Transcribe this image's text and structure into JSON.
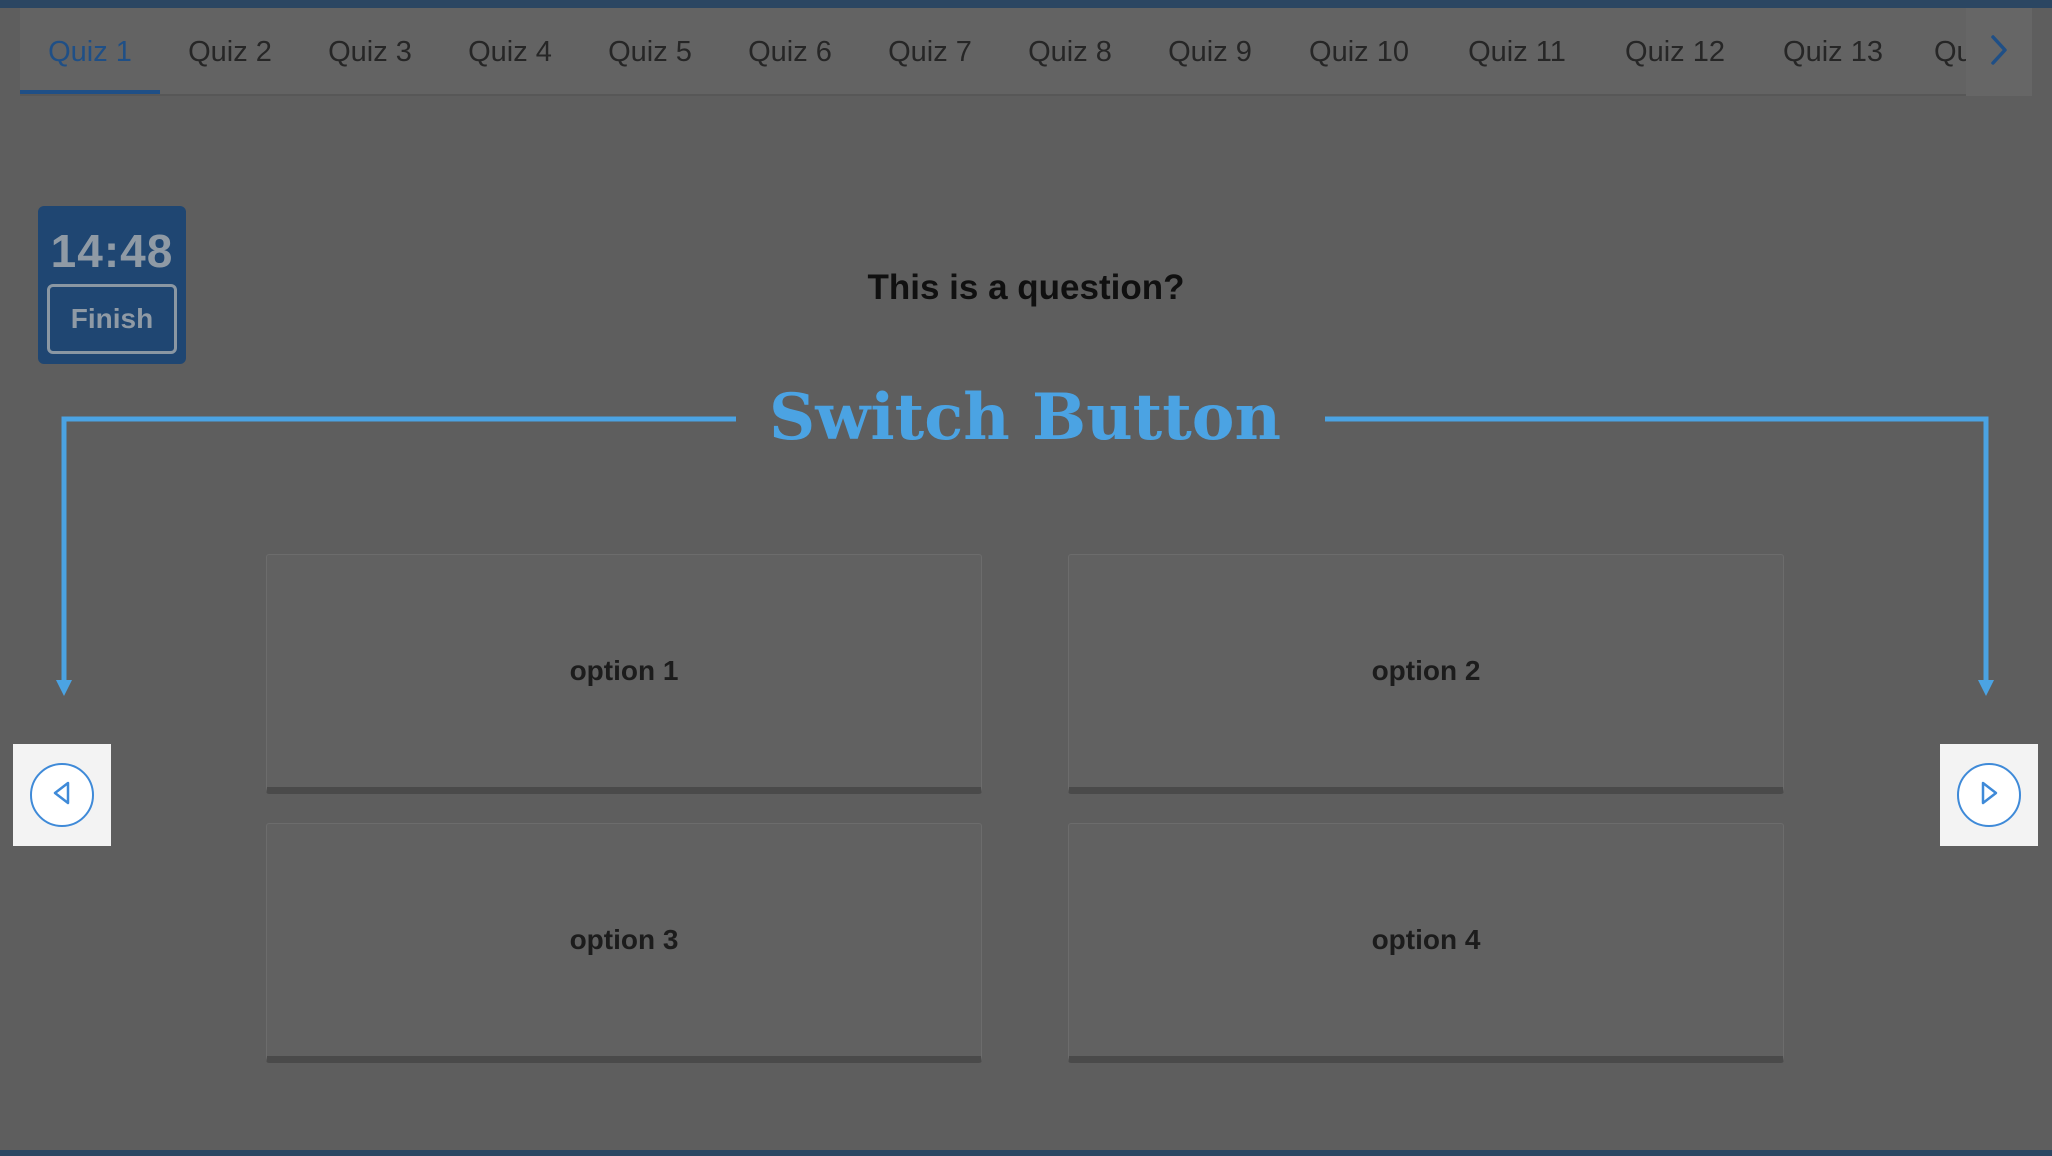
{
  "tabs": [
    {
      "label": "Quiz 1",
      "active": true
    },
    {
      "label": "Quiz 2",
      "active": false
    },
    {
      "label": "Quiz 3",
      "active": false
    },
    {
      "label": "Quiz 4",
      "active": false
    },
    {
      "label": "Quiz 5",
      "active": false
    },
    {
      "label": "Quiz 6",
      "active": false
    },
    {
      "label": "Quiz 7",
      "active": false
    },
    {
      "label": "Quiz 8",
      "active": false
    },
    {
      "label": "Quiz 9",
      "active": false
    },
    {
      "label": "Quiz 10",
      "active": false
    },
    {
      "label": "Quiz 11",
      "active": false
    },
    {
      "label": "Quiz 12",
      "active": false
    },
    {
      "label": "Quiz 13",
      "active": false
    },
    {
      "label": "Qu",
      "active": false
    }
  ],
  "tab_next_icon": "chevron-right-icon",
  "timer": {
    "time": "14:48",
    "finish_label": "Finish"
  },
  "question": {
    "text": "This is a question?",
    "options": [
      "option 1",
      "option 2",
      "option 3",
      "option 4"
    ]
  },
  "annotation": {
    "label": "Switch Button",
    "color": "#4ba3e3"
  },
  "nav": {
    "prev_icon": "triangle-left-icon",
    "next_icon": "triangle-right-icon"
  },
  "colors": {
    "accent": "#1f4f86",
    "background": "#5e5e5e",
    "timer_box": "#1f4672",
    "nav_button_border": "#3f8ad8"
  }
}
